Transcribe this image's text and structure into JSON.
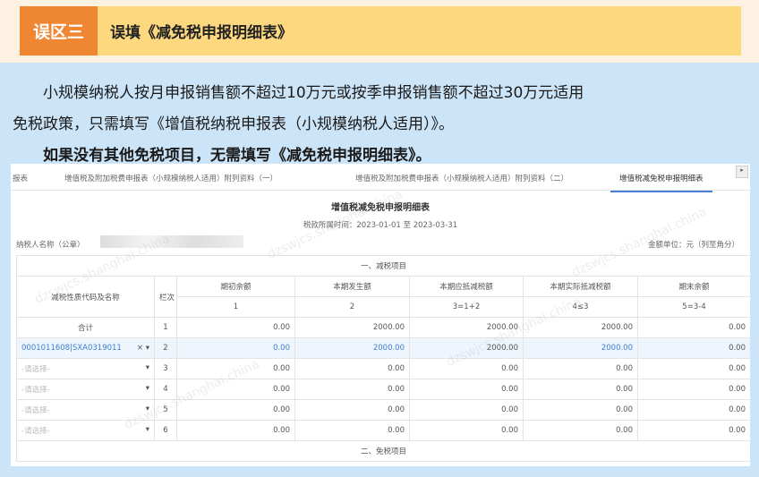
{
  "banner": {
    "tag": "误区三",
    "title": "误填《减免税申报明细表》"
  },
  "body": {
    "line1": "　　小规模纳税人按月申报销售额不超过10万元或按季申报销售额不超过30万元适用",
    "line2": "免税政策，只需填写《增值税纳税申报表（小规模纳税人适用）》。",
    "line3": "　　如果没有其他免税项目，无需填写《减免税申报明细表》。"
  },
  "screen": {
    "tabs": [
      "报表",
      "增值税及附加税费申报表（小规模纳税人适用）附列资料（一）",
      "增值税及附加税费申报表（小规模纳税人适用）附列资料（二）",
      "增值税减免税申报明细表"
    ],
    "title": "增值税减免税申报明细表",
    "period": "税款所属时间：2023-01-01 至 2023-03-31",
    "taxpayer_label": "纳税人名称（公章）",
    "unit": "金额单位：元（列至角分）",
    "section1": "一、减税项目",
    "section2": "二、免税项目",
    "headers": {
      "code": "减税性质代码及名称",
      "row": "栏次",
      "cols": [
        "期初余额",
        "本期发生额",
        "本期应抵减税额",
        "本期实际抵减税额",
        "期末余额"
      ],
      "formulas": [
        "1",
        "2",
        "3=1+2",
        "4≤3",
        "5=3-4"
      ]
    },
    "rows": [
      {
        "name": "合计",
        "no": "1",
        "v": [
          "0.00",
          "2000.00",
          "2000.00",
          "2000.00",
          "0.00"
        ]
      },
      {
        "name": "0001011608|SXA0319011",
        "no": "2",
        "v": [
          "0.00",
          "2000.00",
          "2000.00",
          "2000.00",
          "0.00"
        ]
      },
      {
        "name": "-请选择-",
        "no": "3",
        "v": [
          "0.00",
          "0.00",
          "0.00",
          "0.00",
          "0.00"
        ]
      },
      {
        "name": "-请选择-",
        "no": "4",
        "v": [
          "0.00",
          "0.00",
          "0.00",
          "0.00",
          "0.00"
        ]
      },
      {
        "name": "-请选择-",
        "no": "5",
        "v": [
          "0.00",
          "0.00",
          "0.00",
          "0.00",
          "0.00"
        ]
      },
      {
        "name": "-请选择-",
        "no": "6",
        "v": [
          "0.00",
          "0.00",
          "0.00",
          "0.00",
          "0.00"
        ]
      }
    ],
    "watermark": "dzswjcs.shanghai.china"
  }
}
